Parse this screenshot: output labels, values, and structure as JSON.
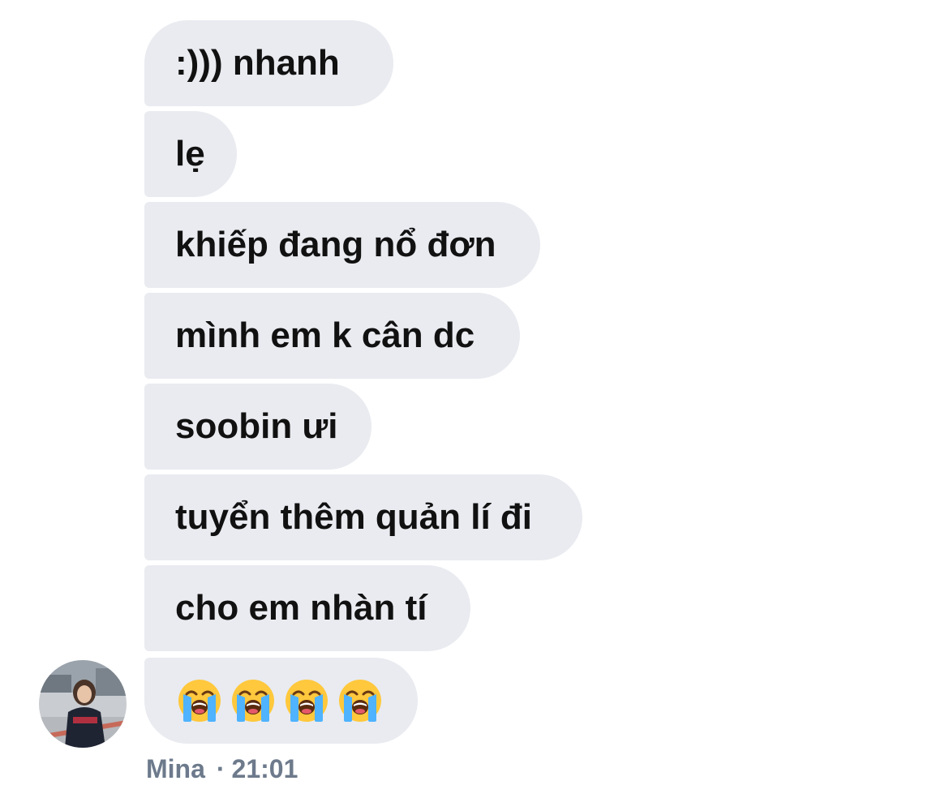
{
  "conversation": {
    "sender": "Mina",
    "timestamp": "21:01",
    "separator": "·",
    "messages": [
      ":))) nhanh",
      "lẹ",
      "khiếp đang nổ đơn",
      "mình em k cân dc",
      "soobin ưi",
      "tuyển thêm quản lí đi",
      "cho em nhàn tí"
    ],
    "emoji_message": {
      "emoji": [
        "loudly-crying-face",
        "loudly-crying-face",
        "loudly-crying-face",
        "loudly-crying-face"
      ]
    }
  },
  "colors": {
    "bubble_bg": "#e9ebf0",
    "text": "#111111",
    "meta": "#6d7a8c"
  }
}
